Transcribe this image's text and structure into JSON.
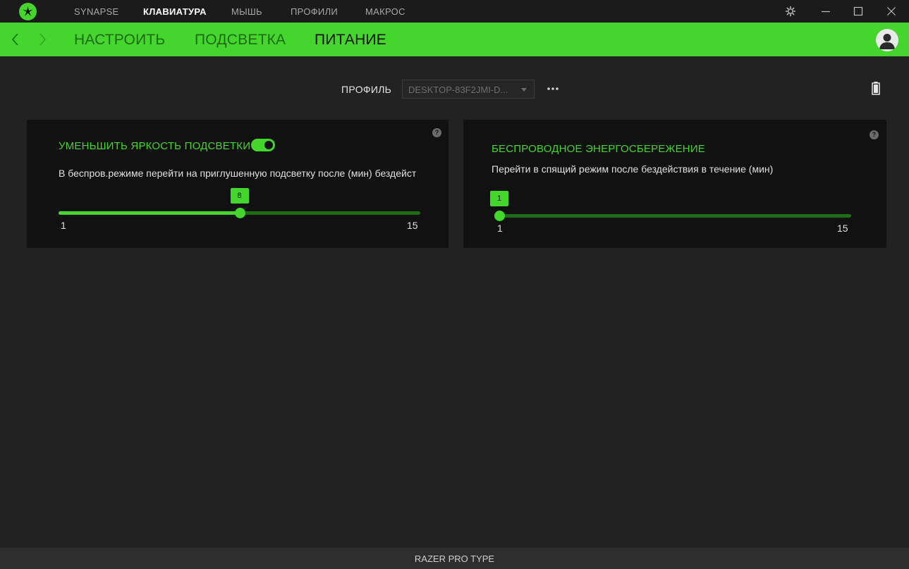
{
  "app": {
    "colors": {
      "accent": "#44d62c",
      "background": "#222222",
      "panel": "#111111",
      "titlebar": "#1b1b1b"
    }
  },
  "top_nav": {
    "items": [
      {
        "label": "SYNAPSE",
        "active": false
      },
      {
        "label": "КЛАВИАТУРА",
        "active": true
      },
      {
        "label": "МЫШЬ",
        "active": false
      },
      {
        "label": "ПРОФИЛИ",
        "active": false
      },
      {
        "label": "МАКРОС",
        "active": false
      }
    ],
    "icons": [
      "razer-logo-icon",
      "settings-gear-icon",
      "minimize-icon",
      "maximize-icon",
      "close-icon"
    ]
  },
  "sub_nav": {
    "tabs": [
      {
        "label": "НАСТРОИТЬ",
        "active": false
      },
      {
        "label": "ПОДСВЕТКА",
        "active": false
      },
      {
        "label": "ПИТАНИЕ",
        "active": true
      }
    ],
    "icons": [
      "back-arrow-icon",
      "forward-arrow-icon",
      "user-avatar-icon"
    ]
  },
  "profile": {
    "label": "ПРОФИЛЬ",
    "selected": "DESKTOP-83F2JMI-D...",
    "icons": [
      "more-dots-icon",
      "battery-icon"
    ]
  },
  "panels": {
    "lighting": {
      "title": "УМЕНЬШИТЬ ЯРКОСТЬ ПОДСВЕТКИ",
      "toggle_on": true,
      "description": "В беспров.режиме перейти на приглушенную подсветку после (мин) бездейст",
      "slider": {
        "min": 1,
        "max": 15,
        "value": 8,
        "min_label": "1",
        "max_label": "15",
        "value_label": "8"
      }
    },
    "wireless": {
      "title": "БЕСПРОВОДНОЕ ЭНЕРГОСБЕРЕЖЕНИЕ",
      "description": "Перейти в спящий режим после бездействия в течение (мин)",
      "slider": {
        "min": 1,
        "max": 15,
        "value": 1,
        "min_label": "1",
        "max_label": "15",
        "value_label": "1"
      }
    },
    "help_glyph": "?"
  },
  "footer": {
    "device_name": "RAZER PRO TYPE"
  }
}
